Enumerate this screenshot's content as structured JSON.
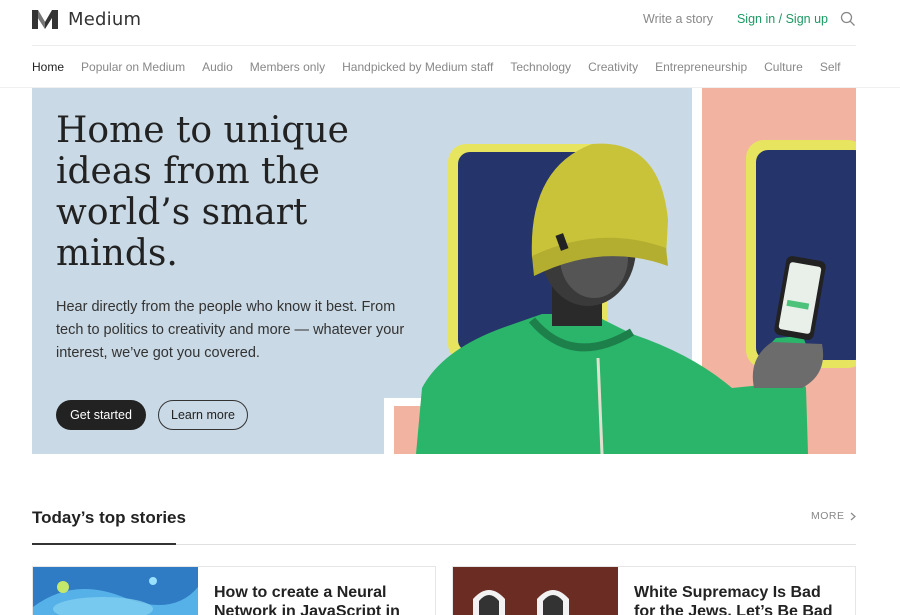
{
  "header": {
    "brand": "Medium",
    "write_label": "Write a story",
    "signin_label": "Sign in / Sign up"
  },
  "nav": {
    "items": [
      "Home",
      "Popular on Medium",
      "Audio",
      "Members only",
      "Handpicked by Medium staff",
      "Technology",
      "Creativity",
      "Entrepreneurship",
      "Culture",
      "Self"
    ],
    "active_index": 0
  },
  "hero": {
    "title": "Home to unique ideas from the world’s smart minds.",
    "subtitle": "Hear directly from the people who know it best. From tech to politics to creativity and more — whatever your interest, we’ve got you covered.",
    "primary_button": "Get started",
    "secondary_button": "Learn more"
  },
  "top_stories": {
    "title": "Today’s top stories",
    "more_label": "MORE",
    "cards": [
      {
        "title": "How to create a Neural Network in JavaScript in only"
      },
      {
        "title": "White Supremacy Is Bad for the Jews. Let’s Be Bad for"
      }
    ]
  },
  "colors": {
    "brand_green": "#1c9963",
    "hero_blue": "#c9d9e5",
    "hero_peach": "#f2b4a0",
    "dark_button": "#222222"
  },
  "icons": [
    "medium-logo-icon",
    "search-icon",
    "chevron-right-icon"
  ]
}
